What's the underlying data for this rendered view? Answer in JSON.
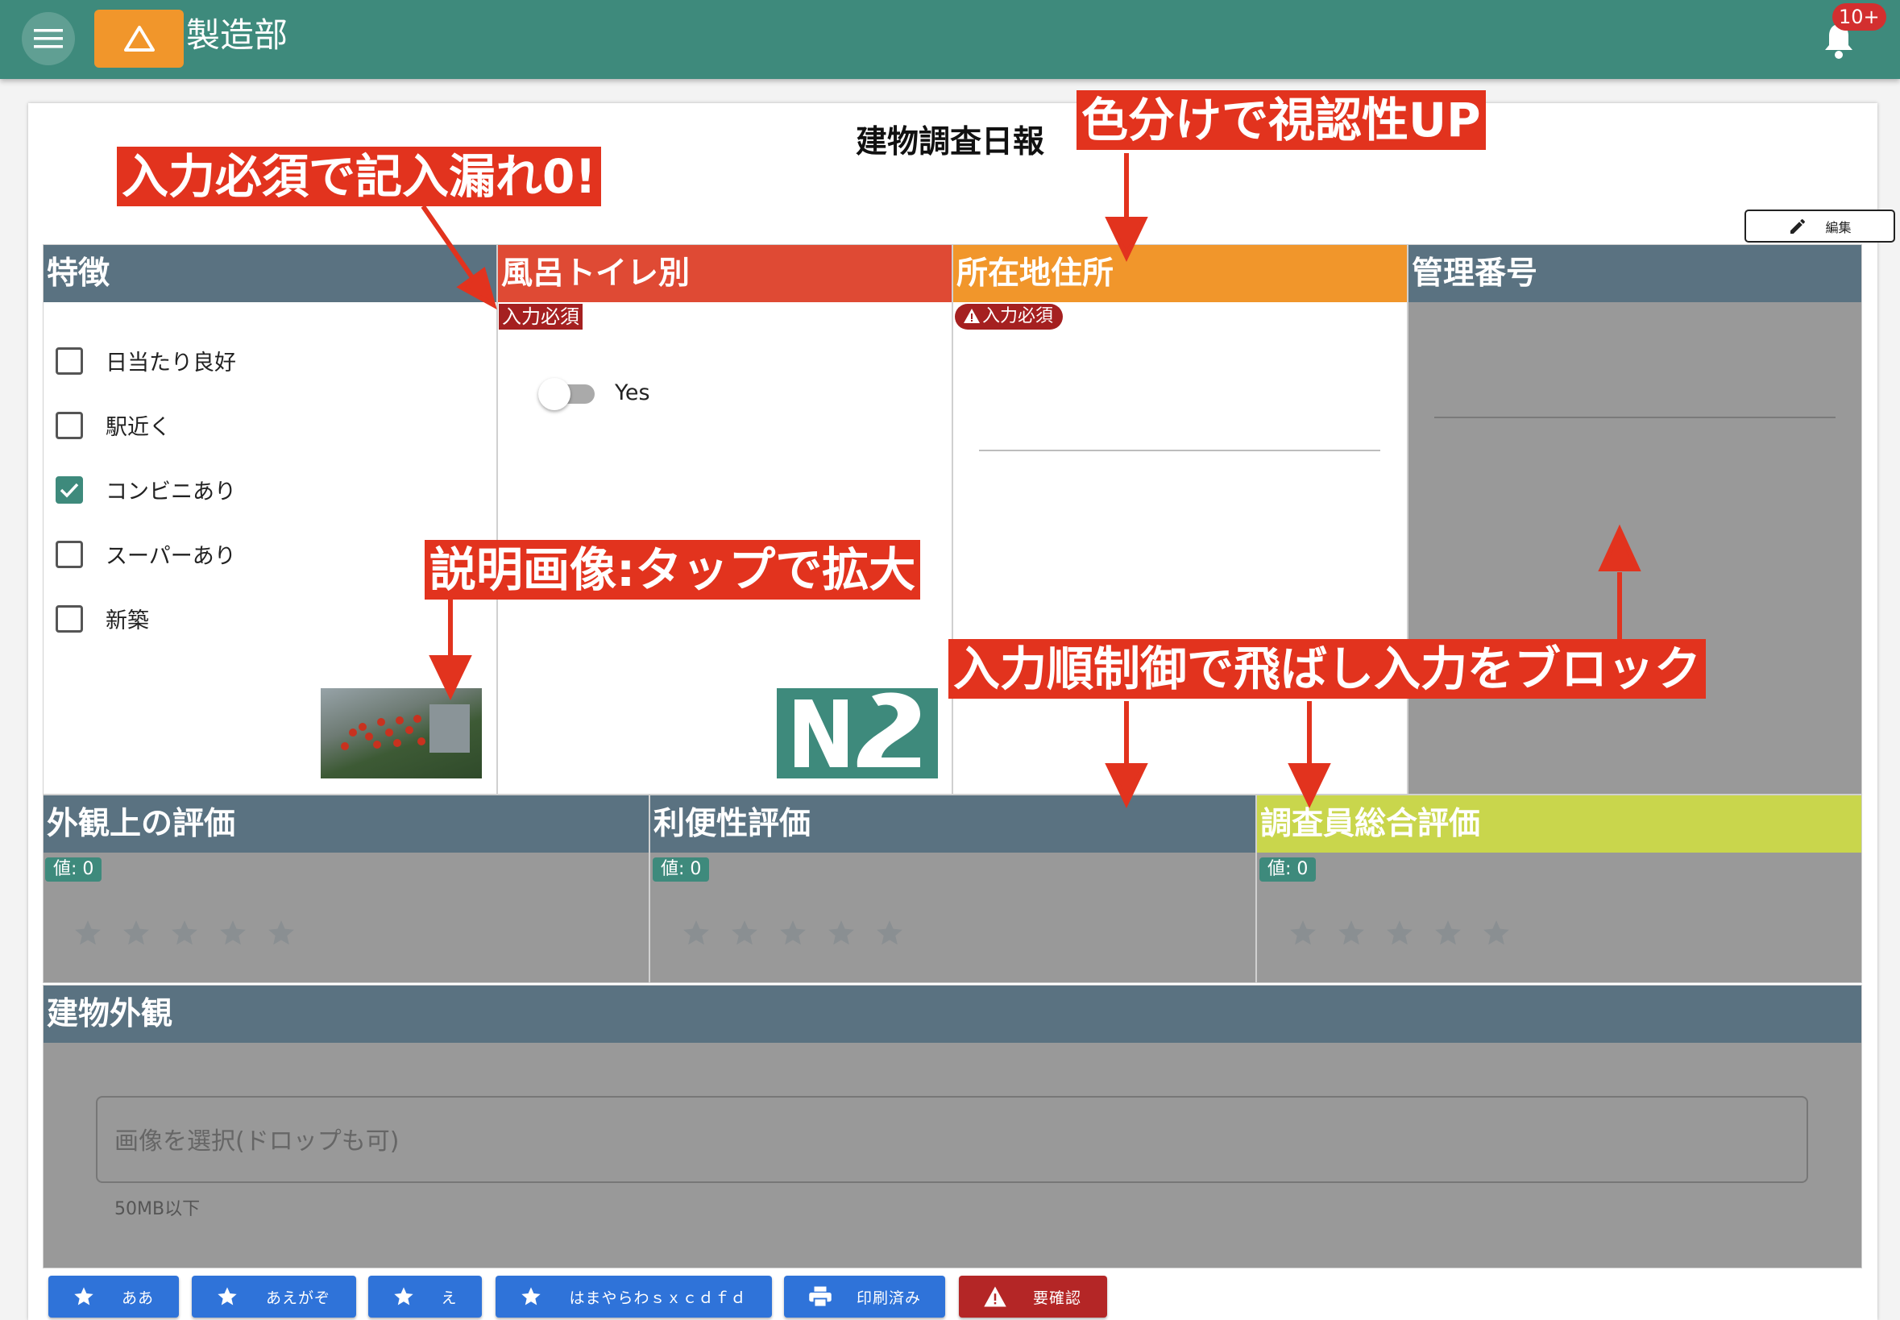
{
  "app": {
    "title": "製造部",
    "notification_count": "10+"
  },
  "form": {
    "title": "建物調査日報",
    "edit_label": "編集"
  },
  "fields": {
    "features": {
      "label": "特徴",
      "options": [
        {
          "label": "日当たり良好",
          "checked": false
        },
        {
          "label": "駅近く",
          "checked": false
        },
        {
          "label": "コンビニあり",
          "checked": true
        },
        {
          "label": "スーパーあり",
          "checked": false
        },
        {
          "label": "新築",
          "checked": false
        }
      ]
    },
    "bath_toilet": {
      "label": "風呂トイレ別",
      "required_tag": "入力必須",
      "toggle_label": "Yes",
      "toggle_on": false
    },
    "address": {
      "label": "所在地住所",
      "required_tag": "入力必須"
    },
    "management_no": {
      "label": "管理番号"
    },
    "exterior_rating": {
      "label": "外観上の評価",
      "value_text": "値: 0",
      "value": 0,
      "max": 5
    },
    "convenience_rating": {
      "label": "利便性評価",
      "value_text": "値: 0",
      "value": 0,
      "max": 5
    },
    "overall_rating": {
      "label": "調査員総合評価",
      "value_text": "値: 0",
      "value": 0,
      "max": 5
    },
    "building_exterior": {
      "label": "建物外観",
      "placeholder": "画像を選択(ドロップも可)",
      "hint": "50MB以下"
    }
  },
  "buttons": [
    {
      "label": "ああ",
      "icon": "star-icon",
      "color": "#2f73d9"
    },
    {
      "label": "あえがぞ",
      "icon": "star-icon",
      "color": "#2f73d9"
    },
    {
      "label": "え",
      "icon": "star-icon",
      "color": "#2f73d9"
    },
    {
      "label": "はまやらわｓｘｃｄｆｄ",
      "icon": "star-icon",
      "color": "#2f73d9"
    },
    {
      "label": "印刷済み",
      "icon": "printer-icon",
      "color": "#2f73d9"
    },
    {
      "label": "要確認",
      "icon": "warning-icon",
      "color": "#b42626"
    }
  ],
  "annotations": {
    "required": "入力必須で記入漏れ0!",
    "color": "色分けで視認性UP",
    "image": "説明画像:タップで拡大",
    "order": "入力順制御で飛ばし入力をブロック"
  },
  "colors": {
    "app_bar": "#3e8a7c",
    "accent_orange": "#f1962b",
    "required": "#a52020",
    "annotation": "#e2331e",
    "section_gray": "#5a7281",
    "highlight_red": "#df4a34",
    "highlight_lime": "#c9d64c"
  }
}
